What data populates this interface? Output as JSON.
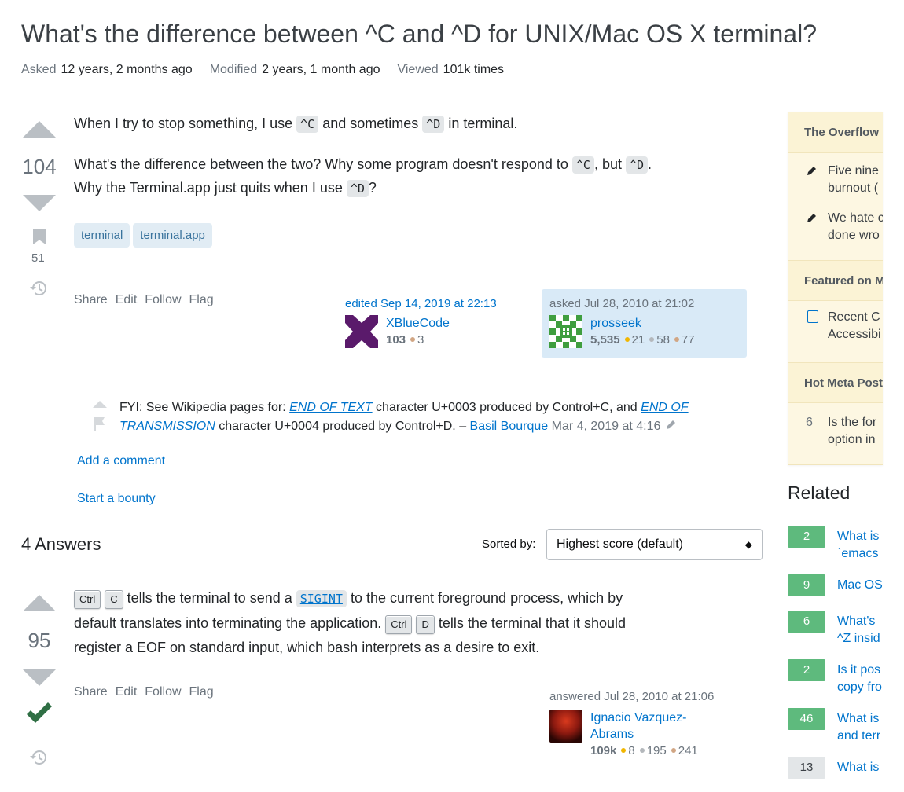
{
  "question": {
    "title": "What's the difference between ^C and ^D for UNIX/Mac OS X terminal?",
    "asked_label": "Asked",
    "asked_value": "12 years, 2 months ago",
    "modified_label": "Modified",
    "modified_value": "2 years, 1 month ago",
    "viewed_label": "Viewed",
    "viewed_value": "101k times",
    "score": "104",
    "bookmark_count": "51",
    "p1_a": "When I try to stop something, I use ",
    "p1_code1": "^C",
    "p1_b": " and sometimes ",
    "p1_code2": "^D",
    "p1_c": " in terminal.",
    "p2_a": "What's the difference between the two? Why some program doesn't respond to ",
    "p2_code1": "^C",
    "p2_b": ", but ",
    "p2_code2": "^D",
    "p2_c": ".",
    "p3_a": "Why the Terminal.app just quits when I use ",
    "p3_code": "^D",
    "p3_b": "?",
    "tags": [
      "terminal",
      "terminal.app"
    ],
    "menu": [
      "Share",
      "Edit",
      "Follow",
      "Flag"
    ],
    "editor": {
      "label": "edited Sep 14, 2019 at 22:13",
      "name": "XBlueCode",
      "rep": "103",
      "bronze": "3"
    },
    "asker": {
      "label": "asked Jul 28, 2010 at 21:02",
      "name": "prosseek",
      "rep": "5,535",
      "gold": "21",
      "silver": "58",
      "bronze": "77"
    },
    "comment": {
      "a": "FYI: See Wikipedia pages for: ",
      "link1": "END OF TEXT",
      "b": " character U+0003 produced by Control+C, and ",
      "link2": "END OF TRANSMISSION",
      "c": " character U+0004 produced by Control+D. – ",
      "author": "Basil Bourque",
      "date": " Mar 4, 2019 at 4:16"
    },
    "add_comment": "Add a comment",
    "start_bounty": "Start a bounty"
  },
  "answers_header": {
    "count_label": "4 Answers",
    "sorted_label": "Sorted by:",
    "sort_value": "Highest score (default)"
  },
  "answer": {
    "score": "95",
    "key_ctrl": "Ctrl",
    "key_c": "C",
    "key_d": "D",
    "t1": " tells the terminal to send a ",
    "sigint": "SIGINT",
    "t2": " to the current foreground process, which by",
    "t3": "default translates into terminating the application. ",
    "t4": " tells the terminal that it should",
    "t5": "register a EOF on standard input, which bash interprets as a desire to exit.",
    "menu": [
      "Share",
      "Edit",
      "Follow",
      "Flag"
    ],
    "author": {
      "label": "answered Jul 28, 2010 at 21:06",
      "name1": "Ignacio Vazquez-",
      "name2": "Abrams",
      "rep": "109k",
      "gold": "8",
      "silver": "195",
      "bronze": "241"
    }
  },
  "sidebar": {
    "blog_head": "The Overflow Blog",
    "blog_items": [
      [
        "Five nine",
        "burnout ("
      ],
      [
        "We hate c",
        "done wro"
      ]
    ],
    "featured_head": "Featured on Meta",
    "featured_item": [
      "Recent C",
      "Accessibi"
    ],
    "hot_head": "Hot Meta Posts",
    "hot_item": {
      "num": "6",
      "l1": "Is the for",
      "l2": "option in"
    }
  },
  "related": {
    "title": "Related",
    "items": [
      {
        "count": "2",
        "l1": "What is",
        "l2": "`emacs"
      },
      {
        "count": "9",
        "l1": "Mac OS",
        "l2": ""
      },
      {
        "count": "6",
        "l1": "What's",
        "l2": "^Z insid"
      },
      {
        "count": "2",
        "l1": "Is it pos",
        "l2": "copy fro"
      },
      {
        "count": "46",
        "l1": "What is",
        "l2": "and terr"
      },
      {
        "count": "13",
        "l1": "What is",
        "l2": ""
      }
    ]
  },
  "colors": {
    "accent": "#0074cc",
    "tag_bg": "#e1ecf4",
    "accepted": "#2f6f44",
    "sidebar_bg": "#fdf7e2",
    "related_badge": "#5eba7d"
  }
}
